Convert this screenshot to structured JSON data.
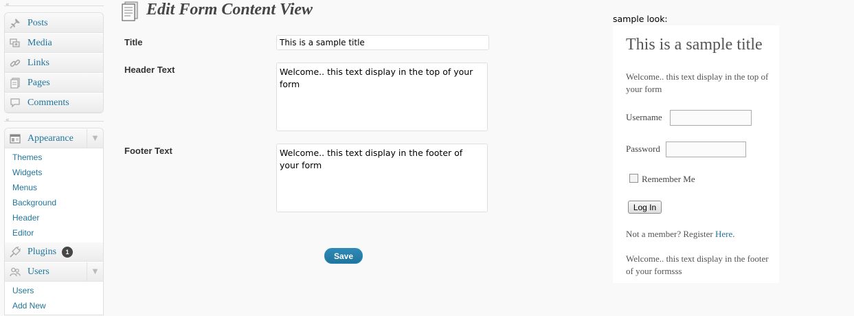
{
  "sidebar": {
    "group1": [
      {
        "label": "Posts",
        "icon": "pushpin-icon"
      },
      {
        "label": "Media",
        "icon": "media-icon"
      },
      {
        "label": "Links",
        "icon": "links-icon"
      },
      {
        "label": "Pages",
        "icon": "pages-icon"
      },
      {
        "label": "Comments",
        "icon": "comment-icon"
      }
    ],
    "appearance": {
      "label": "Appearance",
      "icon": "appearance-icon",
      "submenu": [
        "Themes",
        "Widgets",
        "Menus",
        "Background",
        "Header",
        "Editor"
      ]
    },
    "plugins": {
      "label": "Plugins",
      "icon": "plugin-icon",
      "badge": "1"
    },
    "users": {
      "label": "Users",
      "icon": "users-icon",
      "submenu": [
        "Users",
        "Add New"
      ]
    }
  },
  "main": {
    "title": "Edit Form Content View",
    "fields": {
      "title_label": "Title",
      "title_value": "This is a sample title",
      "header_label": "Header Text",
      "header_value": "Welcome.. this text display in the top of your form",
      "footer_label": "Footer Text",
      "footer_value": "Welcome.. this text display in the footer of your form"
    },
    "save_label": "Save"
  },
  "preview": {
    "label": "sample look:",
    "title": "This is a sample title",
    "header": "Welcome.. this text display in the top of your form",
    "username_label": "Username",
    "password_label": "Password",
    "remember_label": "Remember Me",
    "login_label": "Log In",
    "register_text": "Not a member? Register",
    "register_link": "Here",
    "register_end": ".",
    "footer": "Welcome.. this text display in the footer of your formsss"
  },
  "colors": {
    "link": "#21759b",
    "button": "#21759b",
    "badge": "#464646",
    "background": "#f9f9f9"
  }
}
